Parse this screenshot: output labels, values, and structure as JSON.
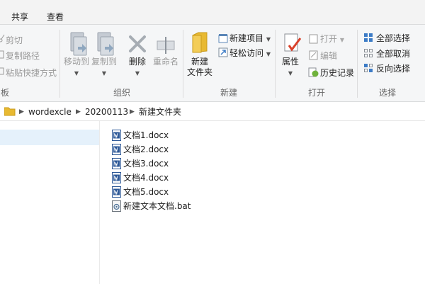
{
  "tabs": [
    "共享",
    "查看"
  ],
  "clipboard": {
    "cut": "剪切",
    "copy_path": "复制路径",
    "paste_shortcut": "粘贴快捷方式",
    "group_label": "板"
  },
  "organize": {
    "move_to": "移动到",
    "copy_to": "复制到",
    "delete": "删除",
    "rename": "重命名",
    "group_label": "组织"
  },
  "new": {
    "new_folder_line1": "新建",
    "new_folder_line2": "文件夹",
    "new_item": "新建项目",
    "easy_access": "轻松访问",
    "group_label": "新建"
  },
  "open": {
    "properties": "属性",
    "open": "打开",
    "edit": "编辑",
    "history": "历史记录",
    "group_label": "打开"
  },
  "select": {
    "select_all": "全部选择",
    "select_none": "全部取消",
    "invert": "反向选择",
    "group_label": "选择"
  },
  "breadcrumb": [
    "wordexcle",
    "20200113",
    "新建文件夹"
  ],
  "files": [
    {
      "name": "文档1.docx",
      "icon": "word-doc-icon"
    },
    {
      "name": "文档2.docx",
      "icon": "word-doc-icon"
    },
    {
      "name": "文档3.docx",
      "icon": "word-doc-icon"
    },
    {
      "name": "文档4.docx",
      "icon": "word-doc-icon"
    },
    {
      "name": "文档5.docx",
      "icon": "word-doc-icon"
    },
    {
      "name": "新建文本文档.bat",
      "icon": "batch-file-icon"
    }
  ],
  "colors": {
    "ribbon_bg": "#f5f6f7",
    "word_blue": "#2b5797",
    "folder_yellow": "#e8b931",
    "nav_selected": "#e5f1fb"
  }
}
